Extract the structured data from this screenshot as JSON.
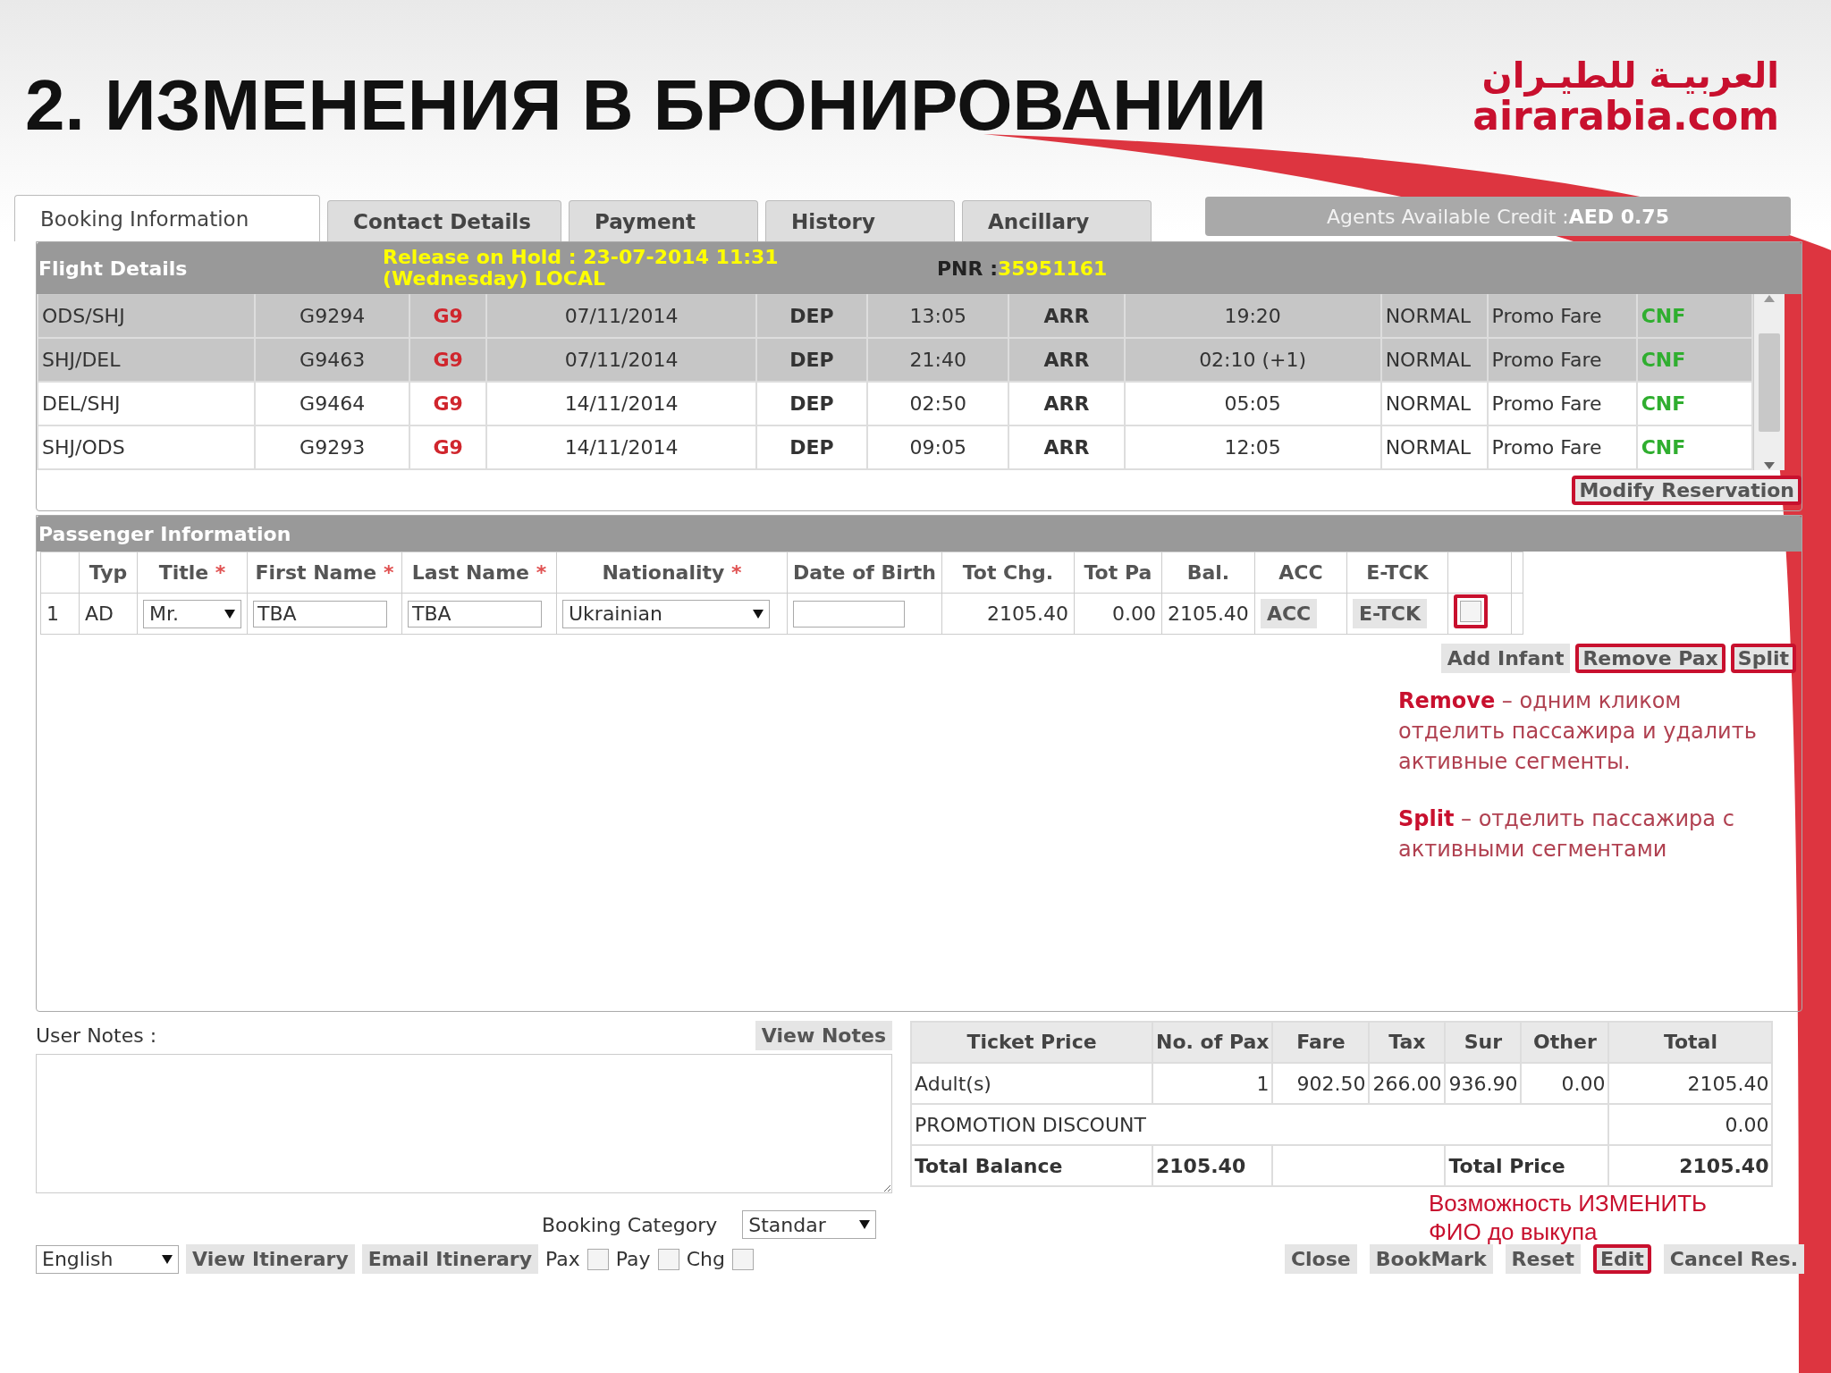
{
  "slide": {
    "title": "2. ИЗМЕНЕНИЯ В БРОНИРОВАНИИ",
    "logo_arabic": "العربيـة للطيـران",
    "logo_latin": "airarabia.com"
  },
  "tabs": [
    {
      "label": "Booking Information",
      "selected": true
    },
    {
      "label": "Contact Details",
      "selected": false
    },
    {
      "label": "Payment",
      "selected": false
    },
    {
      "label": "History",
      "selected": false
    },
    {
      "label": "Ancillary",
      "selected": false
    }
  ],
  "credit": {
    "label": "Agents Available Credit : ",
    "value": "AED 0.75"
  },
  "flight_details": {
    "title": "Flight Details",
    "release": "Release on Hold : 23-07-2014 11:31 (Wednesday) LOCAL",
    "pnr_label": "PNR : ",
    "pnr": "35951161",
    "rows": [
      {
        "selected": true,
        "segment": "ODS/SHJ",
        "flight": "G9294",
        "carrier": "G9",
        "date": "07/11/2014",
        "dep": "DEP",
        "dep_time": "13:05",
        "arr": "ARR",
        "arr_time": "19:20",
        "fare_class": "NORMAL",
        "fare_type": "Promo Fare",
        "status": "CNF"
      },
      {
        "selected": true,
        "segment": "SHJ/DEL",
        "flight": "G9463",
        "carrier": "G9",
        "date": "07/11/2014",
        "dep": "DEP",
        "dep_time": "21:40",
        "arr": "ARR",
        "arr_time": "02:10 (+1)",
        "fare_class": "NORMAL",
        "fare_type": "Promo Fare",
        "status": "CNF"
      },
      {
        "selected": false,
        "segment": "DEL/SHJ",
        "flight": "G9464",
        "carrier": "G9",
        "date": "14/11/2014",
        "dep": "DEP",
        "dep_time": "02:50",
        "arr": "ARR",
        "arr_time": "05:05",
        "fare_class": "NORMAL",
        "fare_type": "Promo Fare",
        "status": "CNF"
      },
      {
        "selected": false,
        "segment": "SHJ/ODS",
        "flight": "G9293",
        "carrier": "G9",
        "date": "14/11/2014",
        "dep": "DEP",
        "dep_time": "09:05",
        "arr": "ARR",
        "arr_time": "12:05",
        "fare_class": "NORMAL",
        "fare_type": "Promo Fare",
        "status": "CNF"
      }
    ],
    "modify_button": {
      "label": "Modify Reservation",
      "highlighted": true
    }
  },
  "passengers": {
    "title": "Passenger Information",
    "columns": [
      {
        "label": "Typ"
      },
      {
        "label": "Title",
        "required_mark": "*"
      },
      {
        "label": "First Name",
        "required_mark": "*"
      },
      {
        "label": "Last Name",
        "required_mark": "*"
      },
      {
        "label": "Nationality",
        "required_mark": "*"
      },
      {
        "label": "Date of Birth"
      },
      {
        "label": "Tot Chg."
      },
      {
        "label": "Tot Pa"
      },
      {
        "label": "Bal."
      },
      {
        "label": "ACC"
      },
      {
        "label": "E-TCK"
      }
    ],
    "rows": [
      {
        "number": "1",
        "type": "AD",
        "title": "Mr.",
        "first_name": "TBA",
        "last_name": "TBA",
        "nationality": "Ukrainian",
        "tot_chg": "2105.40",
        "tot_paid": "0.00",
        "balance": "2105.40",
        "acc": "ACC",
        "etck": "E-TCK",
        "checked": false,
        "highlighted": true
      }
    ],
    "buttons": [
      {
        "label": "Add Infant",
        "highlighted": false
      },
      {
        "label": "Remove Pax",
        "highlighted": true
      },
      {
        "label": "Split",
        "highlighted": true
      }
    ],
    "notes": [
      "**Remove** – одним кликом отделить пассажира и удалить активные сегменты.",
      "**Split** – отделить пассажира с активными сегментами"
    ]
  },
  "user_notes": {
    "label": "User Notes :",
    "button": "View Notes"
  },
  "fares": {
    "columns": [
      "Ticket Price",
      "No. of Pax",
      "Fare",
      "Tax",
      "Sur",
      "Other",
      "Total"
    ],
    "adult": [
      "Adult(s)",
      "1",
      "902.50",
      "266.00",
      "936.90",
      "0.00",
      "2105.40"
    ],
    "promotion": {
      "label": "PROMOTION DISCOUNT",
      "total": "0.00"
    },
    "totals": {
      "balance_label": "Total Balance",
      "balance": "2105.40",
      "price_label": "Total Price",
      "price": "2105.40"
    },
    "note": "Возможность ИЗМЕНИТЬ\nФИО до выкупа"
  },
  "booking_category": {
    "label": "Booking Category",
    "value": "Standar"
  },
  "footer": {
    "language": "English",
    "left_buttons": [
      "View Itinerary",
      "Email Itinerary"
    ],
    "checkboxes": [
      {
        "label": "Pax",
        "checked": false
      },
      {
        "label": "Pay",
        "checked": false
      },
      {
        "label": "Chg",
        "checked": false
      }
    ],
    "right_buttons": [
      {
        "label": "Close",
        "highlighted": false
      },
      {
        "label": "BookMark",
        "highlighted": false
      },
      {
        "label": "Reset",
        "highlighted": false
      },
      {
        "label": "Edit",
        "highlighted": true
      },
      {
        "label": "Cancel Res.",
        "highlighted": false
      }
    ]
  }
}
